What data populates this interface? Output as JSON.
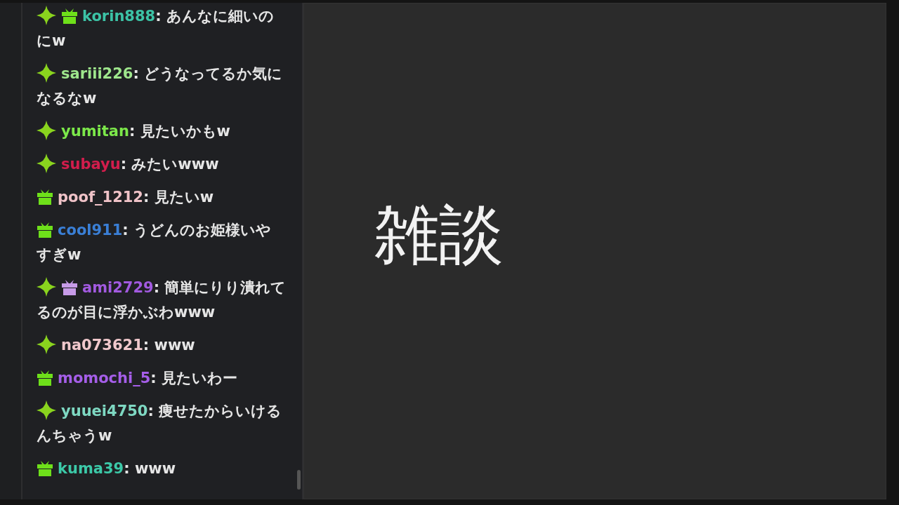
{
  "chat": {
    "messages": [
      {
        "badges": [
          {
            "kind": "sparkle",
            "color": "#8ad41e"
          },
          {
            "kind": "gift",
            "color": "#6ee01a"
          }
        ],
        "user": "korin888",
        "color": "#3cc3a6",
        "text": ": あんなに細いのにw"
      },
      {
        "badges": [
          {
            "kind": "sparkle",
            "color": "#8ad41e"
          }
        ],
        "user": "sariii226",
        "color": "#9ee68c",
        "text": ": どうなってるか気になるなw"
      },
      {
        "badges": [
          {
            "kind": "sparkle",
            "color": "#8ad41e"
          }
        ],
        "user": "yumitan",
        "color": "#7ce84a",
        "text": ": 見たいかもw"
      },
      {
        "badges": [
          {
            "kind": "sparkle",
            "color": "#8ad41e"
          }
        ],
        "user": "subayu",
        "color": "#d21d4c",
        "text": ": みたいwww"
      },
      {
        "badges": [
          {
            "kind": "gift",
            "color": "#6ee01a"
          }
        ],
        "user": "poof_1212",
        "color": "#f0c3c8",
        "text": ": 見たいw"
      },
      {
        "badges": [
          {
            "kind": "gift",
            "color": "#6ee01a"
          }
        ],
        "user": "cool911",
        "color": "#3a7fd6",
        "text": ": うどんのお姫様いやすぎw"
      },
      {
        "badges": [
          {
            "kind": "sparkle",
            "color": "#8ad41e"
          },
          {
            "kind": "gift",
            "color": "#c79be8"
          }
        ],
        "user": "ami2729",
        "color": "#a25ae0",
        "text": ": 簡単にりり潰れてるのが目に浮かぶわwww"
      },
      {
        "badges": [
          {
            "kind": "sparkle",
            "color": "#8ad41e"
          }
        ],
        "user": "na073621",
        "color": "#f0c8cc",
        "text": ": www"
      },
      {
        "badges": [
          {
            "kind": "gift",
            "color": "#6ee01a"
          }
        ],
        "user": "momochi_5",
        "color": "#a55ee8",
        "text": ": 見たいわー"
      },
      {
        "badges": [
          {
            "kind": "sparkle",
            "color": "#8ad41e"
          }
        ],
        "user": "yuuei4750",
        "color": "#7ed8c2",
        "text": ": 痩せたからいけるんちゃうw"
      },
      {
        "badges": [
          {
            "kind": "gift",
            "color": "#6ee01a"
          }
        ],
        "user": "kuma39",
        "color": "#3cc9a8",
        "text": ": www"
      }
    ]
  },
  "stage": {
    "title": "雑談"
  }
}
